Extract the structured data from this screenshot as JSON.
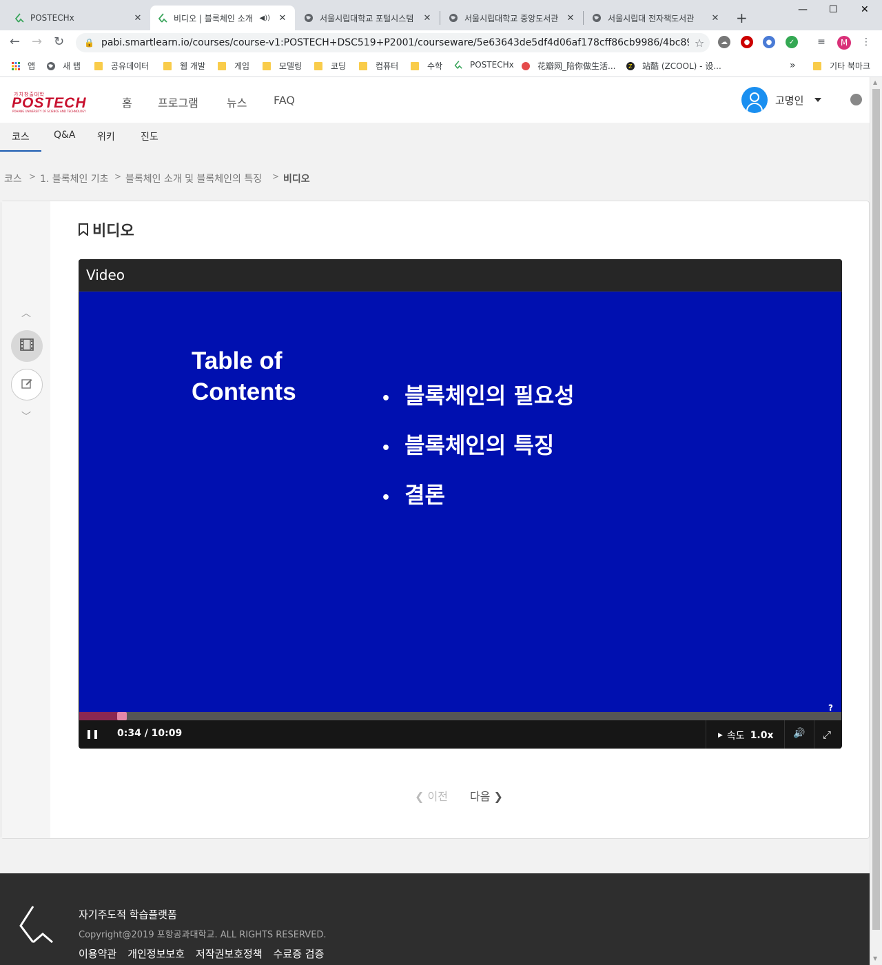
{
  "browser": {
    "tabs": [
      {
        "title": "POSTECHx",
        "active": false
      },
      {
        "title": "비디오 | 블록체인 소개",
        "active": true
      },
      {
        "title": "서울시립대학교 포털시스템",
        "active": false
      },
      {
        "title": "서울시립대학교 중앙도서관",
        "active": false
      },
      {
        "title": "서울시립대 전자책도서관",
        "active": false
      }
    ],
    "new_tab": "+",
    "window_controls": {
      "minimize": "—",
      "maximize": "☐",
      "close": "✕"
    },
    "url": "pabi.smartlearn.io/courses/course-v1:POSTECH+DSC519+P2001/courseware/5e63643de5df4d06af178cff86cb9986/4bc8923f66284d83a...",
    "profile_initial": "M",
    "bookmarks": [
      {
        "label": "앱",
        "icon": "apps-icon"
      },
      {
        "label": "새 탭",
        "icon": "globe-icon"
      },
      {
        "label": "공유데이터",
        "icon": "folder-icon"
      },
      {
        "label": "웹 개발",
        "icon": "folder-icon"
      },
      {
        "label": "게임",
        "icon": "folder-icon"
      },
      {
        "label": "모델링",
        "icon": "folder-icon"
      },
      {
        "label": "코딩",
        "icon": "folder-icon"
      },
      {
        "label": "컴퓨터",
        "icon": "folder-icon"
      },
      {
        "label": "수학",
        "icon": "folder-icon"
      },
      {
        "label": "POSTECHx",
        "icon": "postechx-icon"
      },
      {
        "label": "花瓣网_陪你做生活...",
        "icon": "huaban-icon"
      },
      {
        "label": "站酷 (ZCOOL) - 设...",
        "icon": "zcool-icon"
      }
    ],
    "bookmarks_overflow": "»",
    "other_bookmarks": "기타 북마크"
  },
  "header": {
    "logo_tagline": "가치창출대학",
    "logo_text": "POSTECH",
    "logo_subtext": "POHANG UNIVERSITY OF SCIENCE AND TECHNOLOGY",
    "nav": [
      "홈",
      "프로그램",
      "뉴스",
      "FAQ"
    ],
    "username": "고명인"
  },
  "course_nav": {
    "items": [
      "코스",
      "Q&A",
      "위키",
      "진도"
    ],
    "active_index": 0
  },
  "breadcrumb": {
    "items": [
      "코스",
      "1. 블록체인 기초",
      "블록체인 소개 및 블록체인의 특징",
      "비디오"
    ]
  },
  "unit": {
    "title": "비디오"
  },
  "video": {
    "header": "Video",
    "slide": {
      "heading_line1": "Table of",
      "heading_line2": "Contents",
      "bullets": [
        "블록체인의 필요성",
        "블록체인의 특징",
        "결론"
      ],
      "background": "#0010b0"
    },
    "time": "0:34 / 10:09",
    "progress_fraction": 0.056,
    "speed_label": "속도",
    "speed_value": "1.0x",
    "help_mark": "?"
  },
  "sequence_nav": {
    "prev": "이전",
    "next": "다음"
  },
  "footer": {
    "title": "자기주도적 학습플랫폼",
    "copyright": "Copyright@2019 포항공과대학교. ALL RIGHTS RESERVED.",
    "links": [
      "이용약관",
      "개인정보보호",
      "저작권보호정책",
      "수료증 검증"
    ]
  }
}
